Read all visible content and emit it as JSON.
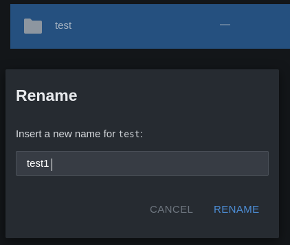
{
  "file_row": {
    "name": "test",
    "size": "—",
    "icon": "folder-icon",
    "highlight_color": "#25507f"
  },
  "dialog": {
    "title": "Rename",
    "prompt_prefix": "Insert a new name for ",
    "prompt_target": "test",
    "prompt_suffix": ":",
    "input_value": "test1",
    "cancel_label": "CANCEL",
    "rename_label": "RENAME",
    "accent_color": "#4d8fd8"
  }
}
